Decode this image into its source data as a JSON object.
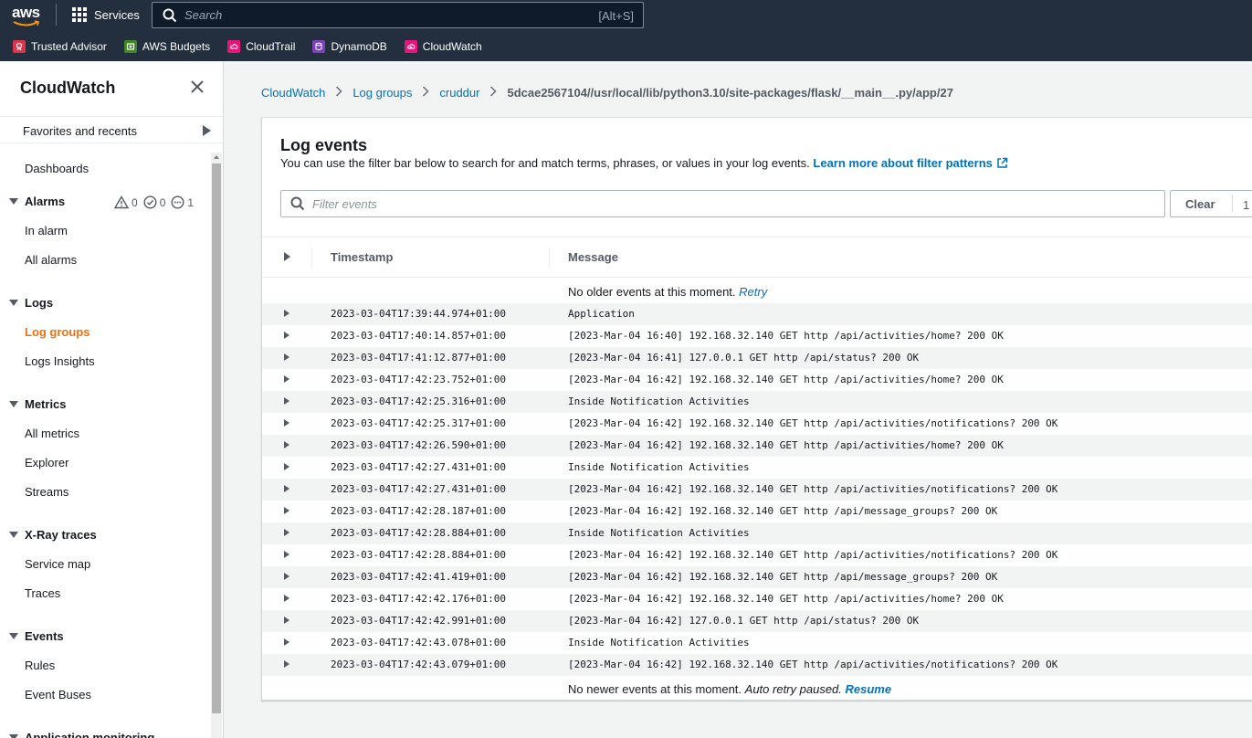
{
  "topnav": {
    "logo_text": "aws",
    "services_label": "Services",
    "search_placeholder": "Search",
    "search_shortcut": "[Alt+S]",
    "favorites": [
      {
        "label": "Trusted Advisor",
        "color": "#dd344c",
        "icon": "trusted-advisor-icon"
      },
      {
        "label": "AWS Budgets",
        "color": "#3f8624",
        "icon": "budgets-icon"
      },
      {
        "label": "CloudTrail",
        "color": "#e7157b",
        "icon": "cloudtrail-icon"
      },
      {
        "label": "DynamoDB",
        "color": "#7b42bc",
        "icon": "dynamodb-icon"
      },
      {
        "label": "CloudWatch",
        "color": "#e7157b",
        "icon": "cloudwatch-icon"
      }
    ]
  },
  "sidebar": {
    "title": "CloudWatch",
    "favorites_recents": "Favorites and recents",
    "dashboards": "Dashboards",
    "alarms": {
      "label": "Alarms",
      "in_alarm_count": "0",
      "ok_count": "0",
      "insufficient_count": "1",
      "items": [
        "In alarm",
        "All alarms"
      ]
    },
    "logs": {
      "label": "Logs",
      "items": [
        "Log groups",
        "Logs Insights"
      ]
    },
    "metrics": {
      "label": "Metrics",
      "items": [
        "All metrics",
        "Explorer",
        "Streams"
      ]
    },
    "xray": {
      "label": "X-Ray traces",
      "items": [
        "Service map",
        "Traces"
      ]
    },
    "events": {
      "label": "Events",
      "items": [
        "Rules",
        "Event Buses"
      ]
    },
    "appmon": {
      "label": "Application monitoring"
    }
  },
  "breadcrumb": {
    "items": [
      "CloudWatch",
      "Log groups",
      "cruddur"
    ],
    "current": "5dcae2567104//usr/local/lib/python3.10/site-packages/flask/__main__.py/app/27"
  },
  "log_events": {
    "title": "Log events",
    "description": "You can use the filter bar below to search for and match terms, phrases, or values in your log events.",
    "learn_more": "Learn more about filter patterns",
    "filter_placeholder": "Filter events",
    "clear_label": "Clear",
    "clear_next": "1",
    "columns": {
      "timestamp": "Timestamp",
      "message": "Message"
    },
    "older_text": "No older events at this moment.",
    "older_retry": "Retry",
    "newer_text": "No newer events at this moment.",
    "newer_paused": "Auto retry paused.",
    "newer_resume": "Resume",
    "rows": [
      {
        "ts": "2023-03-04T17:39:44.974+01:00",
        "msg": "Application"
      },
      {
        "ts": "2023-03-04T17:40:14.857+01:00",
        "msg": "[2023-Mar-04 16:40] 192.168.32.140 GET http /api/activities/home? 200 OK"
      },
      {
        "ts": "2023-03-04T17:41:12.877+01:00",
        "msg": "[2023-Mar-04 16:41] 127.0.0.1 GET http /api/status? 200 OK"
      },
      {
        "ts": "2023-03-04T17:42:23.752+01:00",
        "msg": "[2023-Mar-04 16:42] 192.168.32.140 GET http /api/activities/home? 200 OK"
      },
      {
        "ts": "2023-03-04T17:42:25.316+01:00",
        "msg": "Inside Notification Activities"
      },
      {
        "ts": "2023-03-04T17:42:25.317+01:00",
        "msg": "[2023-Mar-04 16:42] 192.168.32.140 GET http /api/activities/notifications? 200 OK"
      },
      {
        "ts": "2023-03-04T17:42:26.590+01:00",
        "msg": "[2023-Mar-04 16:42] 192.168.32.140 GET http /api/activities/home? 200 OK"
      },
      {
        "ts": "2023-03-04T17:42:27.431+01:00",
        "msg": "Inside Notification Activities"
      },
      {
        "ts": "2023-03-04T17:42:27.431+01:00",
        "msg": "[2023-Mar-04 16:42] 192.168.32.140 GET http /api/activities/notifications? 200 OK"
      },
      {
        "ts": "2023-03-04T17:42:28.187+01:00",
        "msg": "[2023-Mar-04 16:42] 192.168.32.140 GET http /api/message_groups? 200 OK"
      },
      {
        "ts": "2023-03-04T17:42:28.884+01:00",
        "msg": "Inside Notification Activities"
      },
      {
        "ts": "2023-03-04T17:42:28.884+01:00",
        "msg": "[2023-Mar-04 16:42] 192.168.32.140 GET http /api/activities/notifications? 200 OK"
      },
      {
        "ts": "2023-03-04T17:42:41.419+01:00",
        "msg": "[2023-Mar-04 16:42] 192.168.32.140 GET http /api/message_groups? 200 OK"
      },
      {
        "ts": "2023-03-04T17:42:42.176+01:00",
        "msg": "[2023-Mar-04 16:42] 192.168.32.140 GET http /api/activities/home? 200 OK"
      },
      {
        "ts": "2023-03-04T17:42:42.991+01:00",
        "msg": "[2023-Mar-04 16:42] 127.0.0.1 GET http /api/status? 200 OK"
      },
      {
        "ts": "2023-03-04T17:42:43.078+01:00",
        "msg": "Inside Notification Activities"
      },
      {
        "ts": "2023-03-04T17:42:43.079+01:00",
        "msg": "[2023-Mar-04 16:42] 192.168.32.140 GET http /api/activities/notifications? 200 OK"
      }
    ]
  },
  "colors": {
    "topbar": "#232f3e",
    "link": "#0073bb",
    "active_nav": "#ec7211"
  }
}
